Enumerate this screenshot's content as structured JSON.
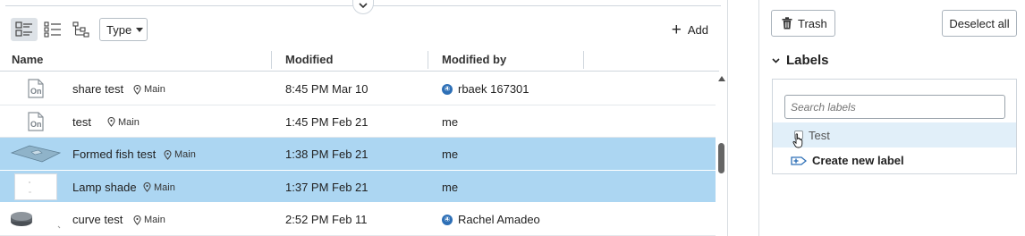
{
  "toolbar": {
    "view_modes": [
      "details-view",
      "list-view",
      "tree-view"
    ],
    "type_filter_label": "Type",
    "add_label": "Add"
  },
  "table": {
    "columns": [
      "Name",
      "Modified",
      "Modified by"
    ],
    "rows": [
      {
        "name": "share test",
        "branch": "Main",
        "modified": "8:45 PM Mar 10",
        "modified_by": "rbaek 167301",
        "badge": true,
        "selected": false,
        "thumb": "onshape-doc-icon"
      },
      {
        "name": "test",
        "branch": "Main",
        "modified": "1:45 PM Feb 21",
        "modified_by": "me",
        "badge": false,
        "selected": false,
        "thumb": "onshape-doc-icon"
      },
      {
        "name": "Formed fish test",
        "branch": "Main",
        "modified": "1:38 PM Feb 21",
        "modified_by": "me",
        "badge": false,
        "selected": true,
        "thumb": "sheet-metal-thumb"
      },
      {
        "name": "Lamp shade",
        "branch": "Main",
        "modified": "1:37 PM Feb 21",
        "modified_by": "me",
        "badge": false,
        "selected": true,
        "thumb": "blank-drawing-thumb"
      },
      {
        "name": "curve test",
        "branch": "Main",
        "modified": "2:52 PM Feb 11",
        "modified_by": "Rachel Amadeo",
        "badge": true,
        "selected": false,
        "thumb": "cylinder-thumb"
      }
    ]
  },
  "side": {
    "trash_label": "Trash",
    "deselect_label": "Deselect all",
    "labels_title": "Labels",
    "search_placeholder": "Search labels",
    "label_items": [
      "Test"
    ],
    "create_label": "Create new label"
  },
  "colors": {
    "selected_row": "#acd6f2",
    "badge": "#2d6fb6",
    "label_hover": "#e1eff9"
  }
}
